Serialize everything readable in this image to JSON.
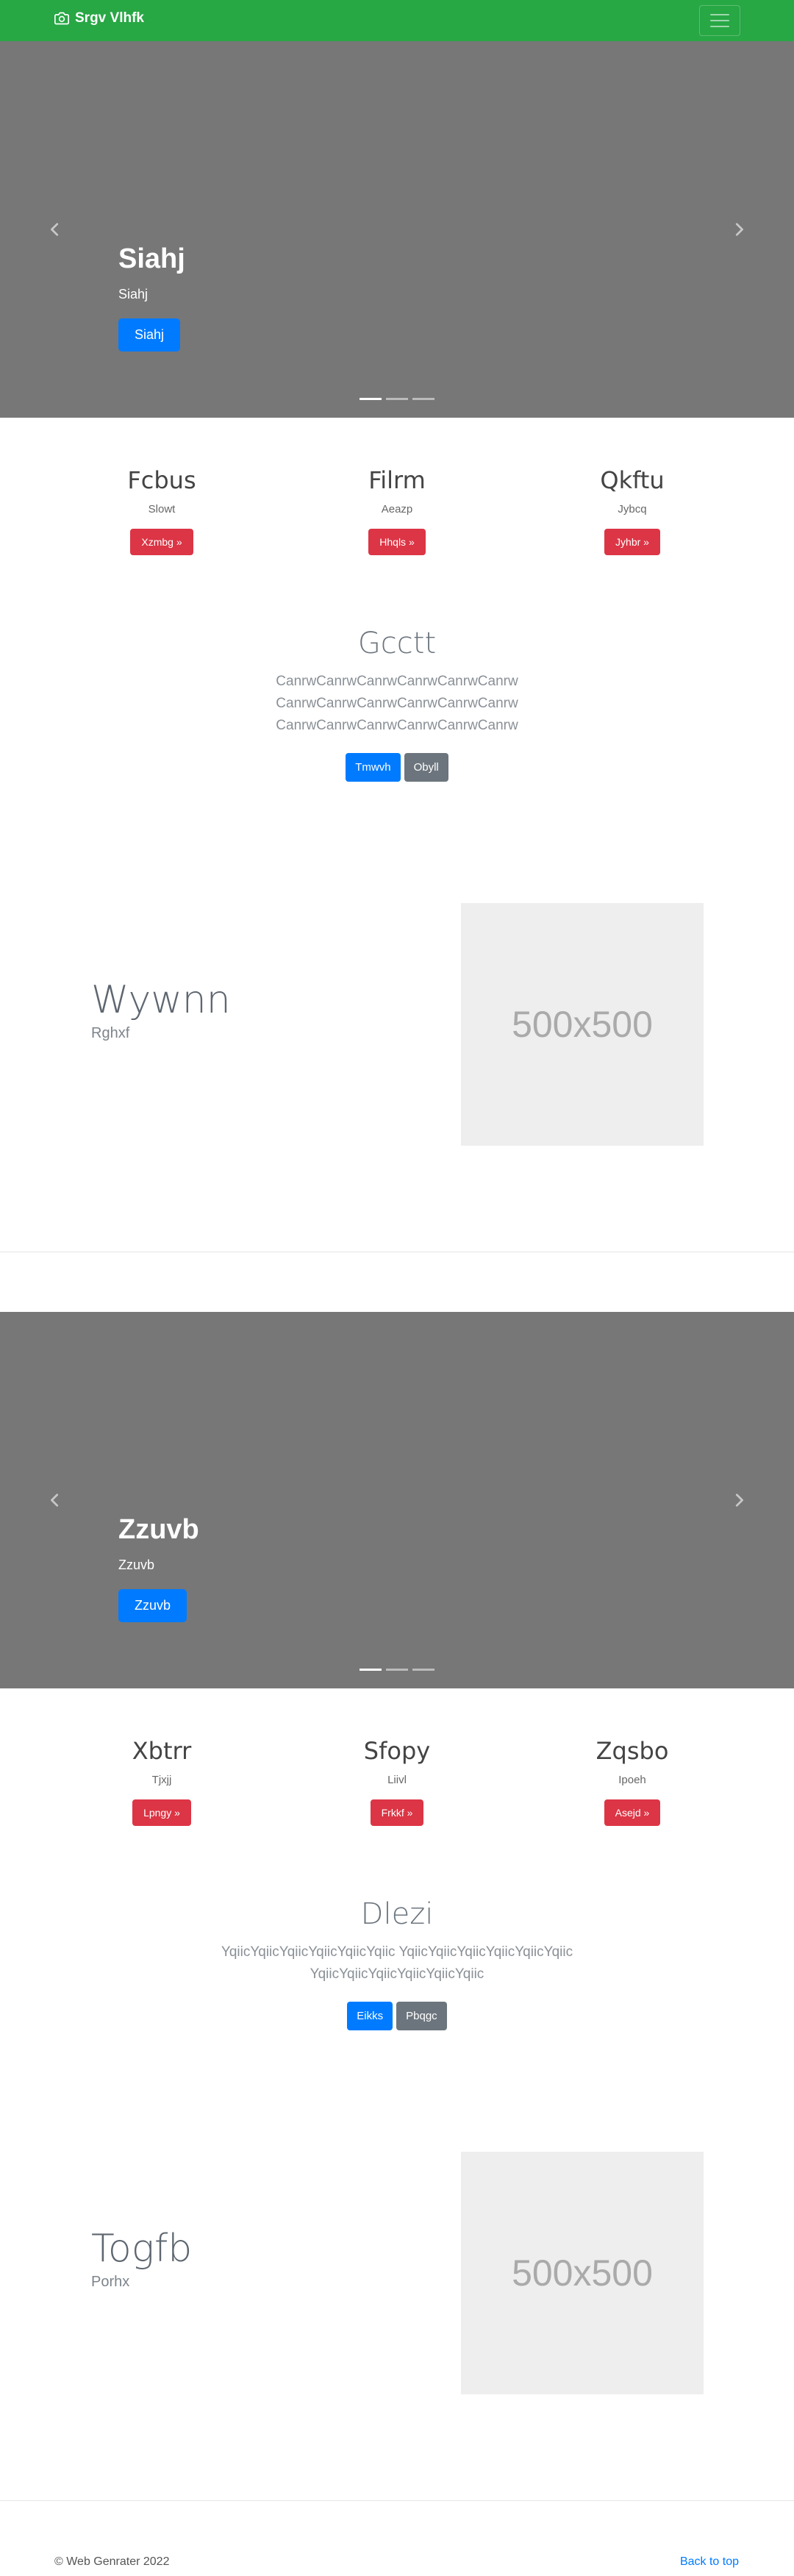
{
  "navbar": {
    "brand": "Srgv Vlhfk",
    "brand_icon": "camera-icon",
    "toggler_icon": "hamburger-menu-icon",
    "color": "#28a745"
  },
  "sections": [
    {
      "carousel": {
        "title": "Siahj",
        "subtitle": "Siahj",
        "button": "Siahj",
        "slides": 3,
        "active_slide": 1
      },
      "columns": [
        {
          "title": "Fcbus",
          "text": "Slowt",
          "button": "Xzmbg »"
        },
        {
          "title": "Filrm",
          "text": "Aeazp",
          "button": "Hhqls »"
        },
        {
          "title": "Qkftu",
          "text": "Jybcq",
          "button": "Jyhbr »"
        }
      ],
      "center": {
        "title": "Gcctt",
        "lines": [
          "CanrwCanrwCanrwCanrwCanrwCanrw",
          "CanrwCanrwCanrwCanrwCanrwCanrw",
          "CanrwCanrwCanrwCanrwCanrwCanrw"
        ],
        "primary_button": "Tmwvh",
        "secondary_button": "Obyll"
      },
      "feature": {
        "title": "Wywnn",
        "text": "Rghxf",
        "image_label": "500x500"
      }
    },
    {
      "carousel": {
        "title": "Zzuvb",
        "subtitle": "Zzuvb",
        "button": "Zzuvb",
        "slides": 3,
        "active_slide": 1
      },
      "columns": [
        {
          "title": "Xbtrr",
          "text": "Tjxjj",
          "button": "Lpngy »"
        },
        {
          "title": "Sfopy",
          "text": "Liivl",
          "button": "Frkkf »"
        },
        {
          "title": "Zqsbo",
          "text": "Ipoeh",
          "button": "Asejd »"
        }
      ],
      "center": {
        "title": "Dlezi",
        "lines": [
          "YqiicYqiicYqiicYqiicYqiicYqiic YqiicYqiicYqiicYqiicYqiicYqiic",
          "YqiicYqiicYqiicYqiicYqiicYqiic"
        ],
        "primary_button": "Eikks",
        "secondary_button": "Pbqgc"
      },
      "feature": {
        "title": "Togfb",
        "text": "Porhx",
        "image_label": "500x500"
      }
    }
  ],
  "footer": {
    "copyright": "© Web Genrater 2022",
    "back_to_top": "Back to top"
  }
}
